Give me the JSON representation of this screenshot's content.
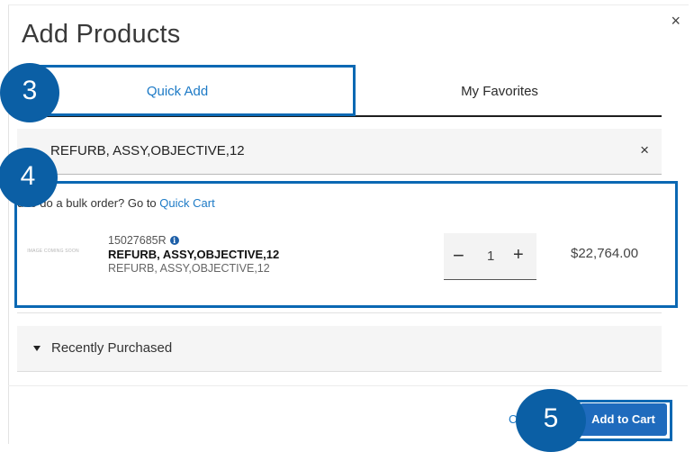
{
  "modal": {
    "title": "Add Products",
    "close_icon": "×"
  },
  "tabs": [
    {
      "label": "Quick Add",
      "active": true
    },
    {
      "label": "My Favorites",
      "active": false
    }
  ],
  "search": {
    "value": "REFURB, ASSY,OBJECTIVE,12",
    "clear_icon": "×"
  },
  "bulk": {
    "text": "d to do a bulk order? Go to ",
    "link": "Quick Cart"
  },
  "product": {
    "thumb_text": "IMAGE COMING SOON",
    "sku": "15027685R",
    "info_icon": "i",
    "name": "REFURB, ASSY,OBJECTIVE,12",
    "description": "REFURB, ASSY,OBJECTIVE,12",
    "quantity": "1",
    "minus": "−",
    "plus": "+",
    "price": "$22,764.00"
  },
  "recently_purchased": {
    "label": "Recently Purchased"
  },
  "footer": {
    "cancel_label": "C",
    "add_label": "Add to Cart"
  },
  "callouts": [
    "3",
    "4",
    "5"
  ],
  "colors": {
    "accent": "#1d7ac6",
    "callout": "#0b5fa5",
    "button": "#1f6bbd"
  }
}
